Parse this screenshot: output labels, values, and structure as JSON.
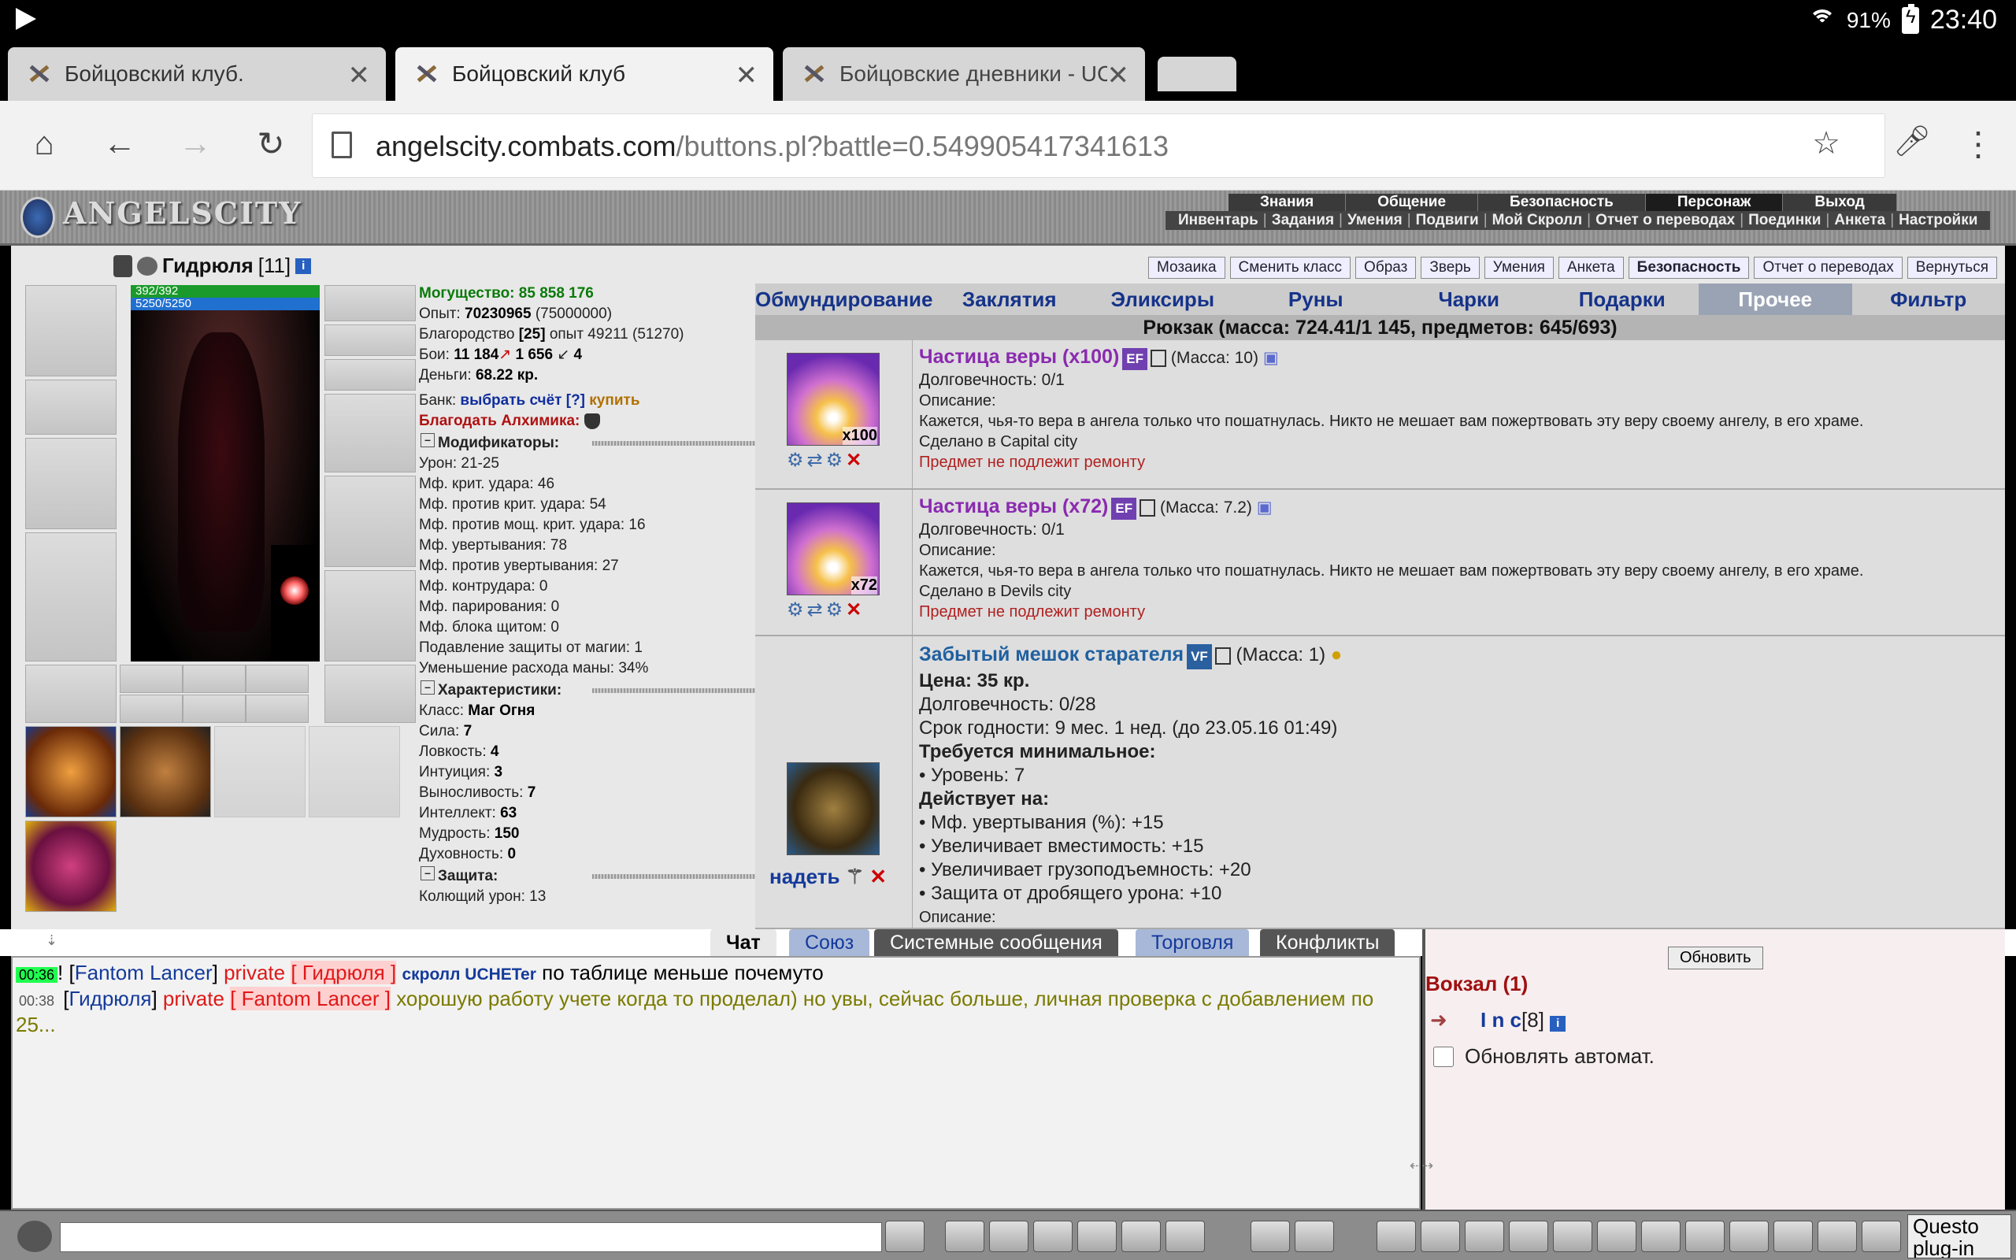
{
  "status": {
    "battery": "91%",
    "time": "23:40"
  },
  "tabs": [
    {
      "label": "Бойцовский клуб."
    },
    {
      "label": "Бойцовский клуб"
    },
    {
      "label": "Бойцовские дневники - UC"
    }
  ],
  "address": {
    "domain": "angelscity.combats.com",
    "path": "/buttons.pl?battle=0.549905417341613"
  },
  "game": {
    "logo": "ANGELSCITY",
    "topmenu": [
      "Знания",
      "Общение",
      "Безопасность",
      "Персонаж",
      "Выход"
    ],
    "submenu": [
      "Инвентарь",
      "Задания",
      "Умения",
      "Подвиги",
      "Мой Скролл",
      "Отчет о переводах",
      "Поединки",
      "Анкета",
      "Настройки"
    ]
  },
  "character": {
    "name": "Гидрюля",
    "level": "[11]",
    "hp": "392/392",
    "mana": "5250/5250"
  },
  "stats": {
    "power": "Могущество: 85 858 176",
    "exp_label": "Опыт:",
    "exp_value": "70230965",
    "exp_next": "(75000000)",
    "nobility_label": "Благородство",
    "nobility_value": "[25]",
    "nobility_rest": "опыт 49211 (51270)",
    "fights_label": "Бои:",
    "fights_win": "11 184",
    "fights_loss": "1 656",
    "fights_draw": "4",
    "money_label": "Деньги:",
    "money_value": "68.22 кр.",
    "bank_label": "Банк:",
    "bank_link": "выбрать счёт [?]",
    "bank_buy": "купить",
    "alch": "Благодать Алхимика:",
    "mods_title": "Модификаторы:",
    "mods": [
      "Урон: 21-25",
      "Мф. крит. удара: 46",
      "Мф. против крит. удара: 54",
      "Мф. против мощ. крит. удара: 16",
      "Мф. увертывания: 78",
      "Мф. против увертывания: 27",
      "Мф. контрудара: 0",
      "Мф. парирования: 0",
      "Мф. блока щитом: 0",
      "Подавление защиты от магии: 1",
      "Уменьшение расхода маны: 34%"
    ],
    "char_title": "Характеристики:",
    "chars": [
      {
        "k": "Класс:",
        "v": "Маг Огня"
      },
      {
        "k": "Сила:",
        "v": "7"
      },
      {
        "k": "Ловкость:",
        "v": "4"
      },
      {
        "k": "Интуиция:",
        "v": "3"
      },
      {
        "k": "Выносливость:",
        "v": "7"
      },
      {
        "k": "Интеллект:",
        "v": "63"
      },
      {
        "k": "Мудрость:",
        "v": "150"
      },
      {
        "k": "Духовность:",
        "v": "0"
      }
    ],
    "def_title": "Защита:",
    "def_first": "Колющий урон: 13"
  },
  "toplinks": [
    "Мозаика",
    "Сменить класс",
    "Образ",
    "Зверь",
    "Умения",
    "Анкета",
    "Безопасность",
    "Отчет о переводах",
    "Вернуться"
  ],
  "invtabs": [
    "Обмундирование",
    "Заклятия",
    "Эликсиры",
    "Руны",
    "Чарки",
    "Подарки",
    "Прочее",
    "Фильтр"
  ],
  "inv_title": "Рюкзак (масса: 724.41/1 145, предметов: 645/693)",
  "items": [
    {
      "title": "Частица веры (x100)",
      "tag": "EF",
      "mass": "(Масса: 10)",
      "qty": "x100",
      "dur": "Долговечность: 0/1",
      "desc_lbl": "Описание:",
      "desc": "Кажется, чья-то вера в ангела только что пошатнулась. Никто не мешает вам пожертвовать эту веру своему ангелу, в его храме.",
      "made": "Сделано в Capital city",
      "norepair": "Предмет не подлежит ремонту"
    },
    {
      "title": "Частица веры (x72)",
      "tag": "EF",
      "mass": "(Масса: 7.2)",
      "qty": "x72",
      "dur": "Долговечность: 0/1",
      "desc_lbl": "Описание:",
      "desc": "Кажется, чья-то вера в ангела только что пошатнулась. Никто не мешает вам пожертвовать эту веру своему ангелу, в его храме.",
      "made": "Сделано в Devils city",
      "norepair": "Предмет не подлежит ремонту"
    },
    {
      "title": "Забытый мешок старателя",
      "tag": "VF",
      "mass": "(Масса: 1)",
      "price": "Цена: 35 кр.",
      "dur": "Долговечность: 0/28",
      "expiry": "Срок годности: 9 мес. 1 нед. (до 23.05.16 01:49)",
      "req_title": "Требуется минимальное:",
      "req": "• Уровень: 7",
      "eff_title": "Действует на:",
      "effects": [
        "• Мф. увертывания (%): +15",
        "• Увеличивает вместимость: +15",
        "• Увеличивает грузоподъемность: +20",
        "• Защита от дробящего урона: +10"
      ],
      "desc_lbl": "Описание:",
      "wear": "надеть"
    }
  ],
  "chattabs": [
    "Чат",
    "Союз",
    "Системные сообщения",
    "Торговля",
    "Конфликты"
  ],
  "chat": [
    {
      "time": "00:36",
      "mark": "!",
      "from": "Fantom Lancer",
      "priv": "private",
      "to": "Гидрюля",
      "pre": "скролл UCHETer",
      "text": "по таблице меньше почемуто"
    },
    {
      "time": "00:38",
      "from": "Гидрюля",
      "priv": "private",
      "to": "Fantom Lancer",
      "text": "хорошую работу учете когда то проделал) но увы, сейчас больше, личная проверка с добавлением по 25..."
    }
  ],
  "side": {
    "refresh": "Обновить",
    "location": "Вокзал (1)",
    "user_name": "I n c",
    "user_level": "[8]",
    "auto": "Обновлять автомат."
  },
  "bottom": {
    "questo": "Questo plug-in non"
  }
}
